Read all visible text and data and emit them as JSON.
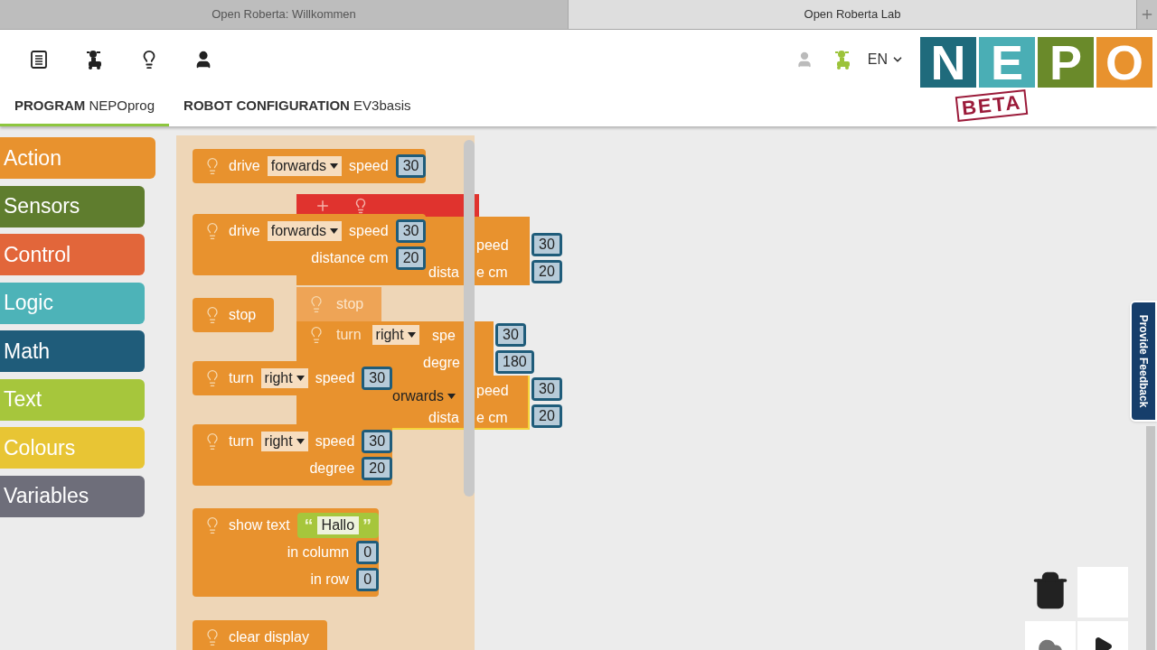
{
  "browser_tabs": [
    {
      "title": "Open Roberta: Willkommen",
      "selected": false
    },
    {
      "title": "Open Roberta Lab",
      "selected": true
    }
  ],
  "header": {
    "language": "EN",
    "logo": {
      "letters": [
        {
          "char": "N",
          "color": "#1f6b7c"
        },
        {
          "char": "E",
          "color": "#4aaeb5"
        },
        {
          "char": "P",
          "color": "#6a8a2a"
        },
        {
          "char": "O",
          "color": "#e8922e"
        }
      ],
      "stamp": "BETA"
    },
    "tabs": [
      {
        "bold": "PROGRAM",
        "name": "NEPOprog",
        "selected": true
      },
      {
        "bold": "ROBOT CONFIGURATION",
        "name": "EV3basis",
        "selected": false
      }
    ]
  },
  "categories": [
    {
      "label": "Action",
      "color": "#e8922e",
      "selected": true
    },
    {
      "label": "Sensors",
      "color": "#5f7d2e",
      "selected": false
    },
    {
      "label": "Control",
      "color": "#e2663a",
      "selected": false
    },
    {
      "label": "Logic",
      "color": "#4db3b8",
      "selected": false
    },
    {
      "label": "Math",
      "color": "#1f5c7a",
      "selected": false
    },
    {
      "label": "Text",
      "color": "#a6c63c",
      "selected": false
    },
    {
      "label": "Colours",
      "color": "#e8c534",
      "selected": false
    },
    {
      "label": "Variables",
      "color": "#6e6e7a",
      "selected": false
    }
  ],
  "flyout_blocks": [
    {
      "rows": [
        {
          "parts": [
            {
              "kind": "label",
              "text": "drive"
            },
            {
              "kind": "dropdown",
              "text": "forwards"
            },
            {
              "kind": "label",
              "text": "speed"
            }
          ],
          "input": {
            "kind": "number",
            "text": "30"
          }
        }
      ]
    },
    {
      "rows": [
        {
          "parts": [
            {
              "kind": "label",
              "text": "drive"
            },
            {
              "kind": "dropdown",
              "text": "forwards"
            },
            {
              "kind": "label",
              "text": "speed"
            }
          ],
          "input": {
            "kind": "number",
            "text": "30"
          }
        },
        {
          "parts": [
            {
              "kind": "label",
              "text": "distance cm"
            }
          ],
          "input": {
            "kind": "number",
            "text": "20"
          }
        }
      ]
    },
    {
      "rows": [
        {
          "parts": [
            {
              "kind": "label",
              "text": "stop"
            }
          ]
        }
      ]
    },
    {
      "rows": [
        {
          "parts": [
            {
              "kind": "label",
              "text": "turn"
            },
            {
              "kind": "dropdown",
              "text": "right"
            },
            {
              "kind": "label",
              "text": "speed"
            }
          ],
          "input": {
            "kind": "number",
            "text": "30"
          }
        }
      ]
    },
    {
      "rows": [
        {
          "parts": [
            {
              "kind": "label",
              "text": "turn"
            },
            {
              "kind": "dropdown",
              "text": "right"
            },
            {
              "kind": "label",
              "text": "speed"
            }
          ],
          "input": {
            "kind": "number",
            "text": "30"
          }
        },
        {
          "parts": [
            {
              "kind": "label",
              "text": "degree"
            }
          ],
          "input": {
            "kind": "number",
            "text": "20"
          }
        }
      ]
    },
    {
      "rows": [
        {
          "parts": [
            {
              "kind": "label",
              "text": "show text"
            }
          ],
          "input": {
            "kind": "text",
            "text": "Hallo",
            "open_quote": "“",
            "close_quote": "”"
          }
        },
        {
          "parts": [
            {
              "kind": "label",
              "text": "in column"
            }
          ],
          "input": {
            "kind": "number",
            "text": "0"
          }
        },
        {
          "parts": [
            {
              "kind": "label",
              "text": "in row"
            }
          ],
          "input": {
            "kind": "number",
            "text": "0"
          }
        }
      ]
    },
    {
      "rows": [
        {
          "parts": [
            {
              "kind": "label",
              "text": "clear display"
            }
          ]
        }
      ]
    }
  ],
  "dragged_stack": {
    "drive_1": {
      "speed_label": "peed",
      "distance_left": "dista",
      "distance_right": "e cm",
      "speed": "30",
      "distance": "20"
    },
    "stop": "stop",
    "turn": {
      "label": "turn",
      "direction": "right",
      "speed_label": "spe",
      "degree_label": "degre",
      "speed": "30",
      "degree": "180"
    },
    "drive_2": {
      "direction": "orwards",
      "speed_label": "peed",
      "distance_left": "dista",
      "distance_right": "e cm",
      "speed": "30",
      "distance": "20"
    }
  },
  "feedback_tab": "Provide Feedback"
}
